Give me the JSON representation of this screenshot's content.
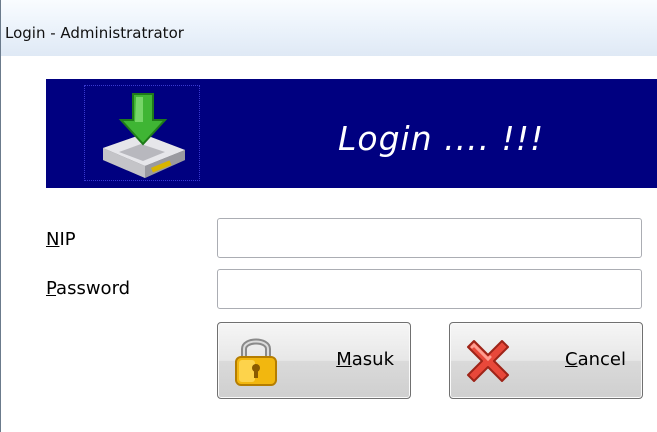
{
  "window": {
    "title": "Login - Administratrator"
  },
  "banner": {
    "title": "Login .... !!!",
    "logo_icon": "download-drive-icon"
  },
  "form": {
    "nip": {
      "label_mnemonic": "N",
      "label_rest": "IP",
      "value": "",
      "placeholder": ""
    },
    "password": {
      "label_mnemonic": "P",
      "label_rest": "assword",
      "value": "",
      "placeholder": ""
    }
  },
  "buttons": {
    "masuk": {
      "label_mnemonic": "M",
      "label_rest": "asuk",
      "icon": "padlock-icon"
    },
    "cancel": {
      "label_mnemonic": "C",
      "label_rest": "ancel",
      "icon": "red-x-icon"
    }
  },
  "colors": {
    "banner_bg": "#000080",
    "banner_text": "#ffffff"
  }
}
